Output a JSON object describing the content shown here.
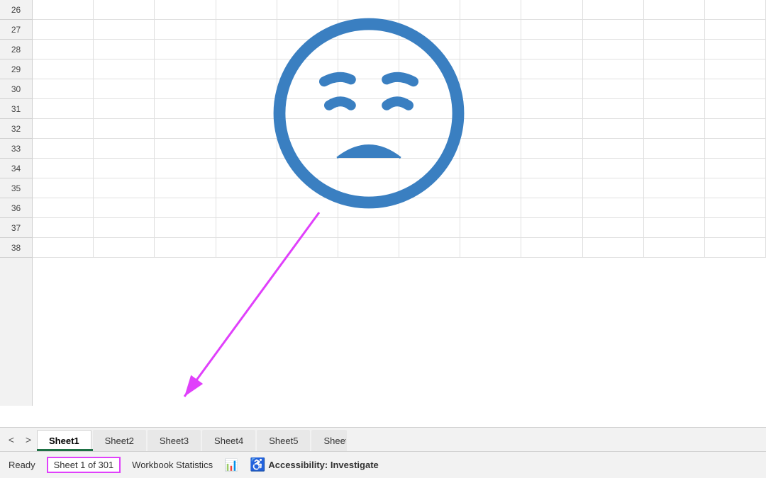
{
  "grid": {
    "rows": [
      26,
      27,
      28,
      29,
      30,
      31,
      32,
      33,
      34,
      35,
      36,
      37,
      38
    ]
  },
  "emoji": {
    "color": "#3a7fc1",
    "description": "sad face emoji"
  },
  "arrow": {
    "color": "#e040fb"
  },
  "sheets": {
    "tabs": [
      "Sheet1",
      "Sheet2",
      "Sheet3",
      "Sheet4",
      "Sheet5",
      "Sheet"
    ],
    "active_index": 0
  },
  "status_bar": {
    "ready_label": "Ready",
    "sheet_count_label": "Sheet 1 of 301",
    "workbook_stats_label": "Workbook Statistics",
    "accessibility_label": "Accessibility: Investigate"
  },
  "nav": {
    "prev_label": "<",
    "next_label": ">"
  }
}
